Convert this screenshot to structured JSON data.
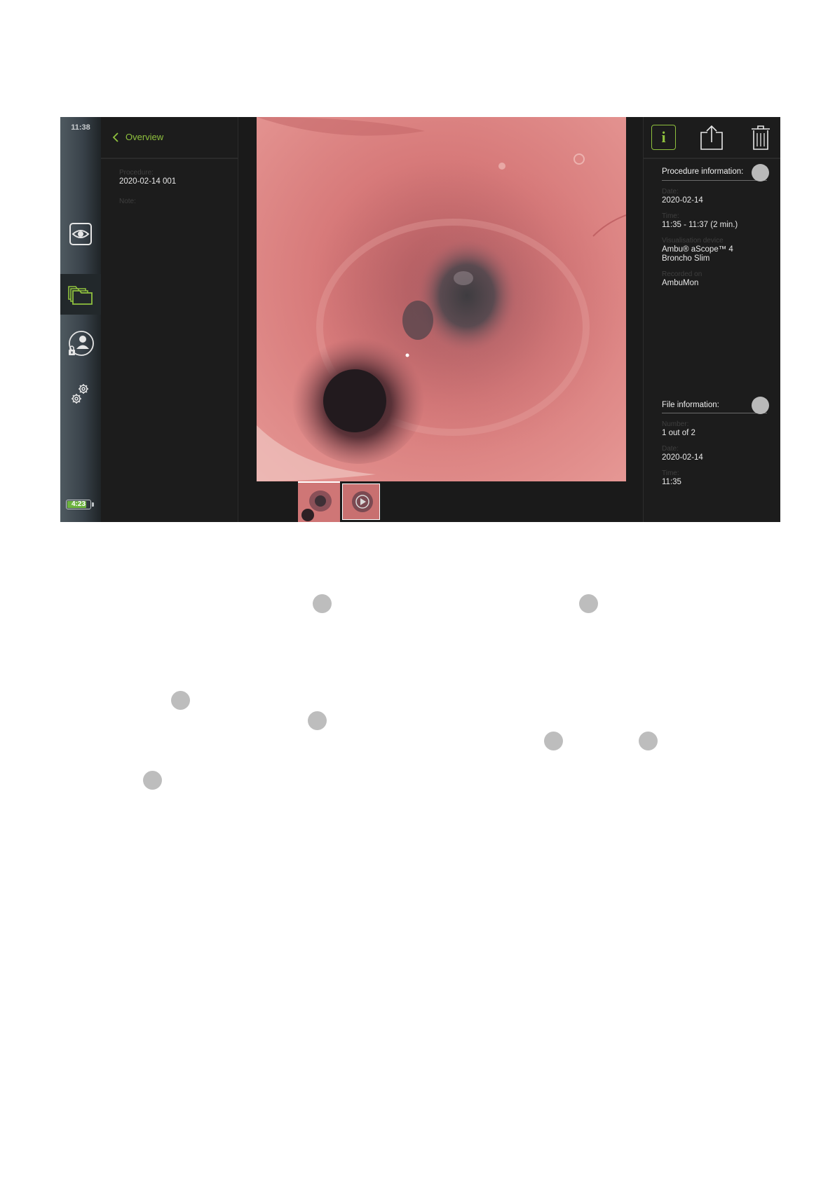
{
  "status": {
    "clock": "11:38",
    "battery": {
      "text": "4:23",
      "level": 0.85
    }
  },
  "nav": {
    "items": [
      {
        "name": "live-view",
        "icon": "eye-icon",
        "active": false
      },
      {
        "name": "archive",
        "icon": "folders-icon",
        "active": true
      },
      {
        "name": "user",
        "icon": "user-lock-icon",
        "active": false
      },
      {
        "name": "settings",
        "icon": "gears-icon",
        "active": false
      }
    ]
  },
  "overview": {
    "back_label": "Overview",
    "procedure_label": "Procedure:",
    "procedure_value": "2020-02-14 001",
    "note_label": "Note:"
  },
  "viewer": {
    "thumbnails": [
      {
        "kind": "image",
        "selected": true
      },
      {
        "kind": "video",
        "selected": false
      }
    ]
  },
  "actions": {
    "info_glyph": "i",
    "info_icon": "info-icon",
    "share_icon": "share-icon",
    "delete_icon": "trash-icon"
  },
  "procedure_info": {
    "title": "Procedure information:",
    "date_label": "Date:",
    "date_value": "2020-02-14",
    "time_label": "Time:",
    "time_value": "11:35 - 11:37 (2 min.)",
    "device_label": "Visualisation device",
    "device_value_line1": "Ambu® aScope™ 4",
    "device_value_line2": "Broncho Slim",
    "recorded_label": "Recorded on",
    "recorded_value": "AmbuMon"
  },
  "file_info": {
    "title": "File information:",
    "number_label": "Number:",
    "number_value": "1 out of 2",
    "date_label": "Date:",
    "date_value": "2020-02-14",
    "time_label": "Time:",
    "time_value": "11:35"
  },
  "colors": {
    "accent": "#8fc13e",
    "background": "#1c1c1c",
    "marker": "#b9b9b9"
  }
}
